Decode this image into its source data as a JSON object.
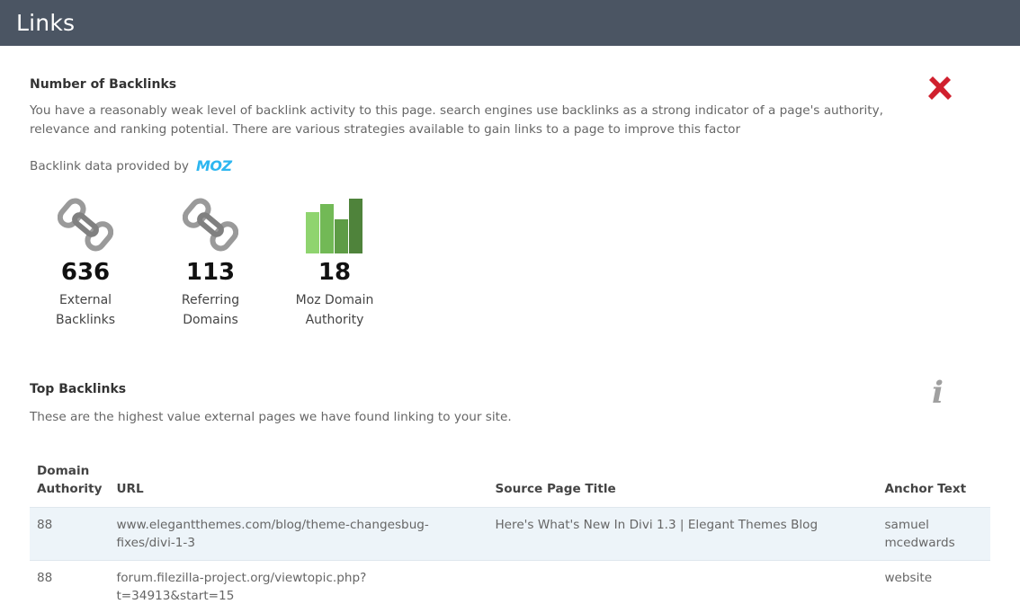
{
  "header": {
    "title": "Links"
  },
  "backlinks_section": {
    "title": "Number of Backlinks",
    "description": "You have a reasonably weak level of backlink activity to this page. search engines use backlinks as a strong indicator of a page's authority, relevance and ranking potential. There are various strategies available to gain links to a page to improve this factor",
    "status_icon": "red-cross-icon",
    "provider_text": "Backlink data provided by",
    "provider_logo": "MOZ",
    "metrics": [
      {
        "icon": "chain-link-icon",
        "value": "636",
        "label": "External Backlinks"
      },
      {
        "icon": "chain-link-icon",
        "value": "113",
        "label": "Referring Domains"
      },
      {
        "icon": "bar-chart-icon",
        "value": "18",
        "label": "Moz Domain Authority"
      }
    ]
  },
  "top_backlinks": {
    "title": "Top Backlinks",
    "description": "These are the highest value external pages we have found linking to your site.",
    "info_icon": "info-icon",
    "info_glyph": "i",
    "columns": [
      "Domain Authority",
      "URL",
      "Source Page Title",
      "Anchor Text"
    ],
    "rows": [
      {
        "domain_authority": "88",
        "url": "www.elegantthemes.com/blog/theme-changesbug-fixes/divi-1-3",
        "source_title": "Here's What's New In Divi 1.3 | Elegant Themes Blog",
        "anchor_text": "samuel mcedwards"
      },
      {
        "domain_authority": "88",
        "url": "forum.filezilla-project.org/viewtopic.php?t=34913&start=15",
        "source_title": "",
        "anchor_text": "website"
      }
    ]
  },
  "colors": {
    "header_bg": "#4b5563",
    "cross_red": "#d0202e",
    "moz_blue": "#2db6f0",
    "bar_greens": [
      "#8fd46f",
      "#72b956",
      "#5e9c46",
      "#4f833b"
    ],
    "row_highlight": "#edf4f9"
  }
}
